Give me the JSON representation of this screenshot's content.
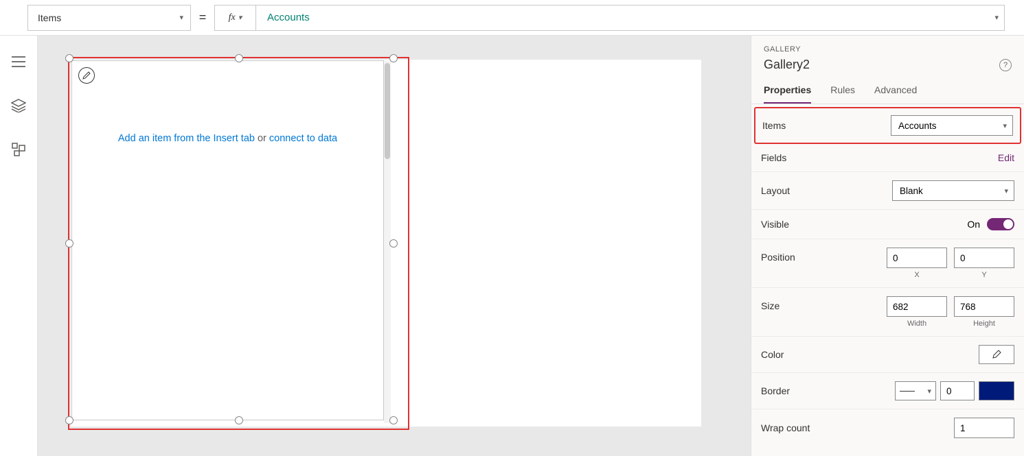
{
  "formula": {
    "property": "Items",
    "fx_label": "fx",
    "value": "Accounts"
  },
  "canvas": {
    "placeholder_link1": "Add an item from the Insert tab",
    "placeholder_or": " or ",
    "placeholder_link2": "connect to data"
  },
  "panel": {
    "type": "GALLERY",
    "name": "Gallery2",
    "tabs": {
      "properties": "Properties",
      "rules": "Rules",
      "advanced": "Advanced"
    },
    "items": {
      "label": "Items",
      "value": "Accounts"
    },
    "fields": {
      "label": "Fields",
      "edit": "Edit"
    },
    "layout": {
      "label": "Layout",
      "value": "Blank"
    },
    "visible": {
      "label": "Visible",
      "state": "On"
    },
    "position": {
      "label": "Position",
      "x": "0",
      "y": "0",
      "xlabel": "X",
      "ylabel": "Y"
    },
    "size": {
      "label": "Size",
      "w": "682",
      "h": "768",
      "wlabel": "Width",
      "hlabel": "Height"
    },
    "color": {
      "label": "Color"
    },
    "border": {
      "label": "Border",
      "width": "0"
    },
    "wrap": {
      "label": "Wrap count",
      "value": "1"
    }
  }
}
